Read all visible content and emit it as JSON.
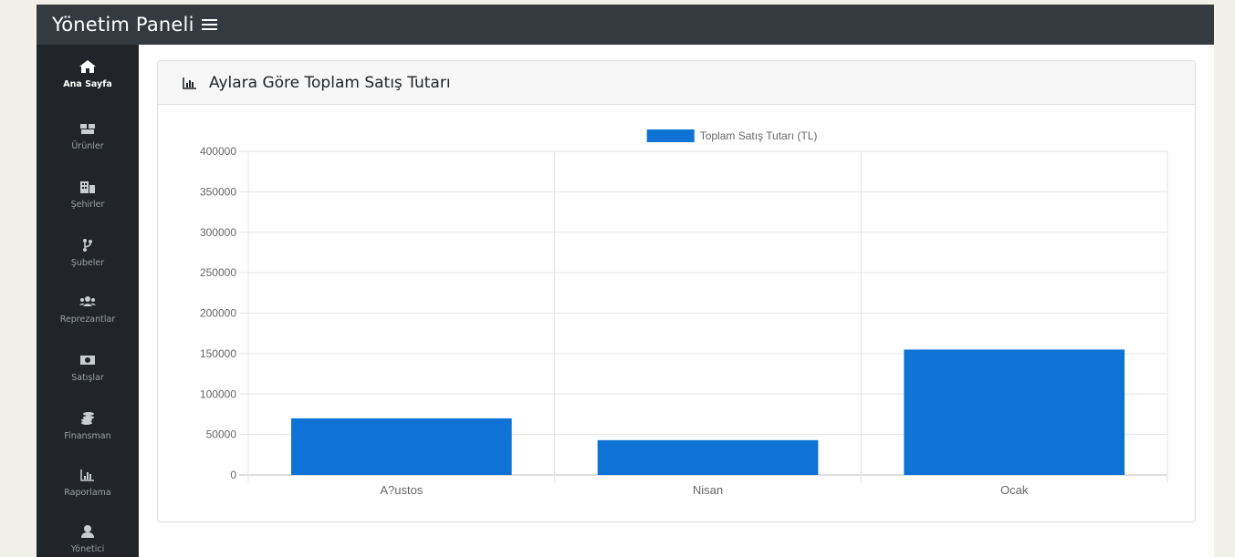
{
  "topbar": {
    "title": "Yönetim Paneli",
    "menu_icon": "hamburger-icon"
  },
  "sidebar": {
    "items": [
      {
        "label": "Ana Sayfa",
        "icon": "home-icon",
        "active": true
      },
      {
        "label": "Ürünler",
        "icon": "boxes-icon",
        "active": false
      },
      {
        "label": "Şehirler",
        "icon": "city-icon",
        "active": false
      },
      {
        "label": "Şubeler",
        "icon": "branch-icon",
        "active": false
      },
      {
        "label": "Reprezantlar",
        "icon": "users-icon",
        "active": false
      },
      {
        "label": "Satışlar",
        "icon": "money-icon",
        "active": false
      },
      {
        "label": "Finansman",
        "icon": "coins-icon",
        "active": false
      },
      {
        "label": "Raporlama",
        "icon": "chart-icon",
        "active": false
      },
      {
        "label": "Yönetici",
        "icon": "user-icon",
        "active": false
      }
    ]
  },
  "card": {
    "title": "Aylara Göre Toplam Satış Tutarı",
    "icon": "chart-bar-icon"
  },
  "colors": {
    "bar": "#0f73d6",
    "topbar": "#343a40",
    "sidebar": "#212529"
  },
  "chart_data": {
    "type": "bar",
    "categories": [
      "A?ustos",
      "Nisan",
      "Ocak"
    ],
    "series": [
      {
        "name": "Toplam Satış Tutarı (TL)",
        "values": [
          70000,
          43000,
          155000
        ]
      }
    ],
    "ylim": [
      0,
      400000
    ],
    "yticks": [
      0,
      50000,
      100000,
      150000,
      200000,
      250000,
      300000,
      350000,
      400000
    ],
    "grid": true,
    "legend": "top-center"
  }
}
